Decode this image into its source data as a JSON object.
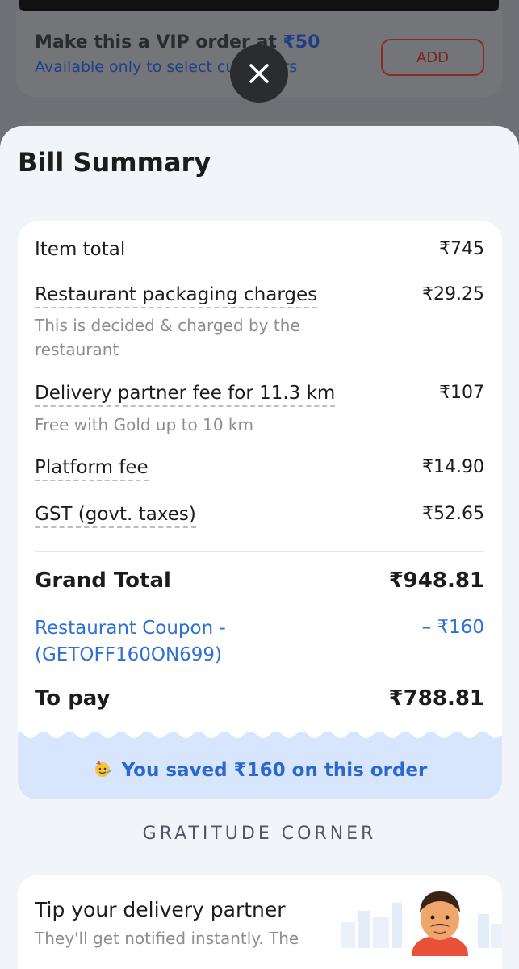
{
  "background": {
    "vip_title_prefix": "Make this a VIP order at ",
    "vip_amount": "₹50",
    "vip_subtitle": "Available only to select customers",
    "vip_add_label": "ADD"
  },
  "close_icon": "close-icon",
  "bill": {
    "title": "Bill Summary",
    "rows": [
      {
        "label": "Item total",
        "amount": "₹745"
      },
      {
        "label": "Restaurant packaging charges",
        "amount": "₹29.25",
        "sub": "This is decided & charged by the restaurant"
      },
      {
        "label": "Delivery partner fee for 11.3 km",
        "amount": "₹107",
        "sub": "Free with Gold up to 10 km"
      },
      {
        "label": "Platform fee",
        "amount": "₹14.90"
      },
      {
        "label": "GST (govt. taxes)",
        "amount": "₹52.65"
      }
    ],
    "grand_total_label": "Grand Total",
    "grand_total_amount": "₹948.81",
    "coupon_label": "Restaurant Coupon - (GETOFF160ON699)",
    "coupon_amount": "– ₹160",
    "to_pay_label": "To pay",
    "to_pay_amount": "₹788.81",
    "saved_text": "You saved ₹160 on this order",
    "saved_icon": "party-face-icon"
  },
  "gratitude": {
    "heading": "GRATITUDE CORNER",
    "tip_title": "Tip your delivery partner",
    "tip_subtitle": "They'll get notified instantly. The"
  },
  "colors": {
    "accent_blue": "#2f6fd6",
    "sheet_bg": "#f1f4f9",
    "saved_bg": "#d7e6fd"
  }
}
